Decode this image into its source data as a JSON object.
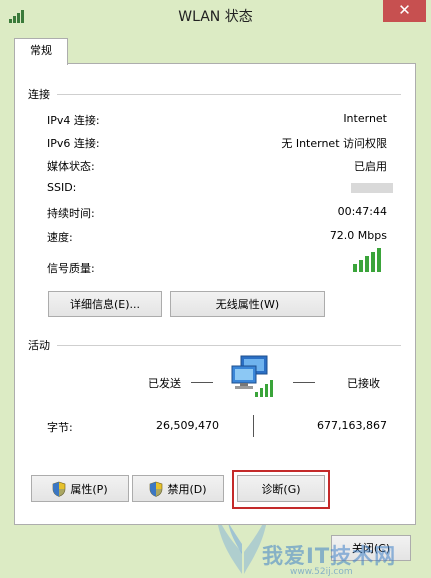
{
  "window": {
    "title": "WLAN 状态",
    "close_glyph": "✕"
  },
  "tabs": [
    {
      "label": "常规"
    }
  ],
  "connection": {
    "section_title": "连接",
    "rows": [
      {
        "label": "IPv4 连接:",
        "value": "Internet"
      },
      {
        "label": "IPv6 连接:",
        "value": "无 Internet 访问权限"
      },
      {
        "label": "媒体状态:",
        "value": "已启用"
      },
      {
        "label": "SSID:",
        "value": ""
      },
      {
        "label": "持续时间:",
        "value": "00:47:44"
      },
      {
        "label": "速度:",
        "value": "72.0 Mbps"
      },
      {
        "label": "信号质量:",
        "value": ""
      }
    ],
    "signal_icon": "signal-strength-icon"
  },
  "connection_buttons": {
    "details": "详细信息(E)...",
    "wireless_properties": "无线属性(W)"
  },
  "activity": {
    "section_title": "活动",
    "sent_label": "已发送",
    "received_label": "已接收",
    "bytes_label": "字节:",
    "bytes_sent": "26,509,470",
    "bytes_received": "677,163,867",
    "network_icon": "network-computers-icon"
  },
  "bottom_buttons": {
    "properties": "属性(P)",
    "disable": "禁用(D)",
    "diagnose": "诊断(G)"
  },
  "footer": {
    "close_button": "关闭(C)"
  },
  "watermark": {
    "text": "我爱IT技术网",
    "url": "www.52ij.com"
  },
  "colors": {
    "window_bg": "#dcebc4",
    "close_button": "#c75050",
    "highlight": "#c42a2a",
    "signal_green": "#3aa43a"
  }
}
